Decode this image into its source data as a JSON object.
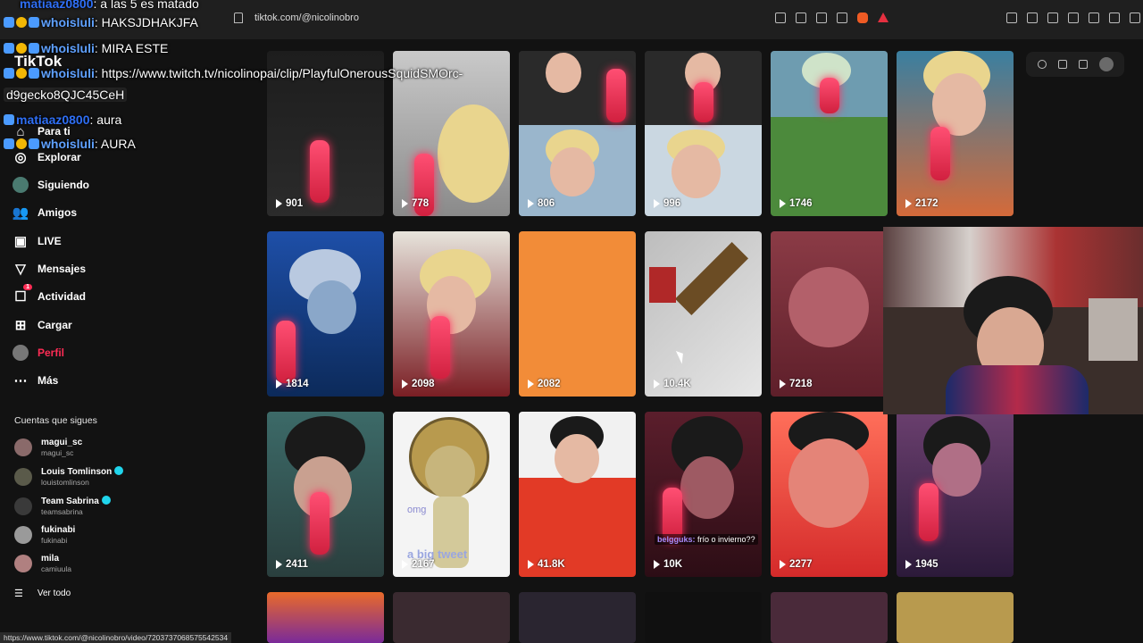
{
  "browser": {
    "url": "tiktok.com/@nicolinobro",
    "status_url": "https://www.tiktok.com/@nicolinobro/video/7203737068575542534"
  },
  "tiktok": {
    "logo": "TikTok",
    "nav": [
      {
        "label": "Para ti",
        "icon": "home-icon"
      },
      {
        "label": "Explorar",
        "icon": "compass-icon"
      },
      {
        "label": "Siguiendo",
        "icon": "following-avatar-icon"
      },
      {
        "label": "Amigos",
        "icon": "friends-icon"
      },
      {
        "label": "LIVE",
        "icon": "live-icon"
      },
      {
        "label": "Mensajes",
        "icon": "send-icon"
      },
      {
        "label": "Actividad",
        "icon": "activity-icon",
        "badge": "1"
      },
      {
        "label": "Cargar",
        "icon": "upload-icon"
      },
      {
        "label": "Perfil",
        "icon": "profile-icon",
        "active": true
      },
      {
        "label": "Más",
        "icon": "more-icon"
      }
    ],
    "following_title": "Cuentas que sigues",
    "following": [
      {
        "name": "magui_sc",
        "handle": "magui_sc",
        "verified": false
      },
      {
        "name": "Louis Tomlinson",
        "handle": "louistomlinson",
        "verified": true
      },
      {
        "name": "Team Sabrina",
        "handle": "teamsabrina",
        "verified": true
      },
      {
        "name": "fukinabi",
        "handle": "fukinabi",
        "verified": false
      },
      {
        "name": "mila",
        "handle": "camiuula",
        "verified": false
      }
    ],
    "see_all": "Ver todo"
  },
  "chat": [
    {
      "user": "matiaaz0800",
      "text": "a las 5 es matado"
    },
    {
      "user": "whoisluli",
      "text": "HAKSJDHAKJFA"
    },
    {
      "user": "whoisluli",
      "text": "MIRA ESTE"
    },
    {
      "user": "whoisluli",
      "text": "https://www.twitch.tv/nicolinopai/clip/PlayfulOnerousSquidSMOrc-"
    },
    {
      "user": "",
      "text": "d9gecko8QJC45CeH"
    },
    {
      "user": "matiaaz0800",
      "text": "aura"
    },
    {
      "user": "whoisluli",
      "text": "AURA"
    }
  ],
  "videos": [
    {
      "views": "901"
    },
    {
      "views": "778"
    },
    {
      "views": "806"
    },
    {
      "views": "996"
    },
    {
      "views": "1746"
    },
    {
      "views": "2172"
    },
    {
      "views": "1814"
    },
    {
      "views": "2098"
    },
    {
      "views": "2082"
    },
    {
      "views": "10.4K"
    },
    {
      "views": "7218"
    },
    {
      "views": "2411"
    },
    {
      "views": "2167"
    },
    {
      "views": "41.8K"
    },
    {
      "views": "10K"
    },
    {
      "views": "2277"
    },
    {
      "views": "1945"
    }
  ],
  "captions": {
    "omg": "omg",
    "tweet": "a big tweet",
    "caption_user": "belgguks:",
    "caption_text": "frío o invierno??"
  },
  "colors": {
    "accent": "#fe2c55",
    "chat_user": "#5fa1ff",
    "verified": "#20d5ec"
  }
}
